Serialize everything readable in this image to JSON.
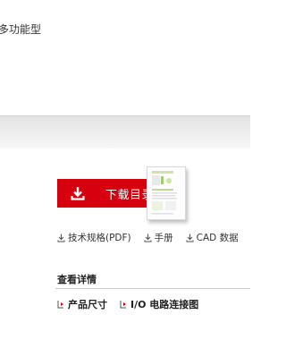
{
  "product": {
    "type_text": "多功能型"
  },
  "download": {
    "button_label": "下载目录",
    "icon": "download-icon",
    "catalog_thumbnail": "catalog-thumbnail-image"
  },
  "doc_links": [
    {
      "label": "技术规格(PDF)",
      "icon": "download-icon"
    },
    {
      "label": "手册",
      "icon": "download-icon"
    },
    {
      "label": "CAD 数据",
      "icon": "download-icon"
    }
  ],
  "details": {
    "heading": "查看详情",
    "links": [
      {
        "label": "产品尺寸",
        "icon": "arrow-right-icon"
      },
      {
        "label": "I/O 电路连接图",
        "icon": "arrow-right-icon"
      }
    ]
  },
  "colors": {
    "accent_red": "#d7000f",
    "band_gray": "#ebebeb"
  }
}
